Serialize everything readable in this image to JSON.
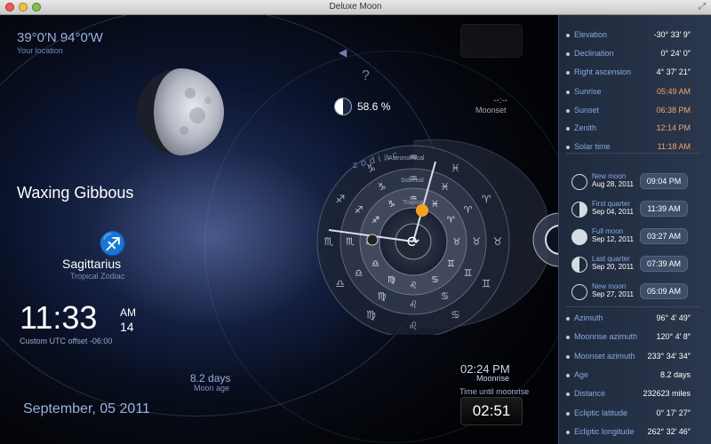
{
  "window": {
    "title": "Deluxe Moon"
  },
  "location": {
    "coords": "39°0′N 94°0′W",
    "label": "Your location"
  },
  "phase": {
    "name": "Waxing Gibbous",
    "illumination": "58.6 %"
  },
  "zodiac": {
    "glyph": "♐",
    "name": "Sagittarius",
    "system": "Tropical Zodiac"
  },
  "time": {
    "clock": "11:33",
    "ampm": "AM",
    "seconds": "14",
    "utc_offset": "Custom UTC offset -06:00"
  },
  "moon_age": {
    "value": "8.2 days",
    "label": "Moon age"
  },
  "date": "September, 05 2011",
  "moonset": {
    "value": "--:--",
    "label": "Moonset"
  },
  "moonrise": {
    "time": "02:24 PM",
    "label": "Moonrise",
    "until_label": "Time until moonrise",
    "countdown": "02:51"
  },
  "dial": {
    "word": "zodiac",
    "rings": [
      "Astronomical",
      "Sidereal",
      "Tropical"
    ],
    "outer_signs": [
      "♐",
      "♑",
      "♒",
      "♓",
      "♈",
      "♉",
      "♊",
      "♋",
      "♌",
      "♍",
      "♎",
      "♏"
    ],
    "middle_signs": [
      "♐",
      "♑",
      "♒",
      "♓",
      "♈",
      "♉",
      "♊",
      "♋",
      "♌",
      "♍",
      "♎",
      "♏"
    ],
    "inner_signs": [
      "♐",
      "♑",
      "♒",
      "♓",
      "♈",
      "♉",
      "♊",
      "♋",
      "♌",
      "♍",
      "♎",
      "♏"
    ],
    "center_icon": "refresh-icon"
  },
  "colors": {
    "accent": "#8aa8e3",
    "orange": "#f0a66c",
    "panel": "#26324a"
  },
  "coordinates": [
    {
      "label": "Elevation",
      "value": "-30° 33′ 9″",
      "highlight": false
    },
    {
      "label": "Declination",
      "value": "0° 24′ 0″",
      "highlight": false
    },
    {
      "label": "Right ascension",
      "value": "4° 37′ 21″",
      "highlight": false
    }
  ],
  "times": [
    {
      "label": "Sunrise",
      "value": "05:49 AM",
      "highlight": true
    },
    {
      "label": "Sunset",
      "value": "06:38 PM",
      "highlight": true
    },
    {
      "label": "Zenith",
      "value": "12:14 PM",
      "highlight": true
    },
    {
      "label": "Solar time",
      "value": "11:18 AM",
      "highlight": true
    }
  ],
  "phases": [
    {
      "name": "New moon",
      "date": "Aug 28, 2011",
      "time": "09:04 PM",
      "icon": "new-moon-icon"
    },
    {
      "name": "First quarter",
      "date": "Sep 04, 2011",
      "time": "11:39 AM",
      "icon": "first-quarter-icon"
    },
    {
      "name": "Full moon",
      "date": "Sep 12, 2011",
      "time": "03:27 AM",
      "icon": "full-moon-icon"
    },
    {
      "name": "Last quarter",
      "date": "Sep 20, 2011",
      "time": "07:39 AM",
      "icon": "last-quarter-icon"
    },
    {
      "name": "New moon",
      "date": "Sep 27, 2011",
      "time": "05:09 AM",
      "icon": "new-moon-icon"
    }
  ],
  "details": [
    {
      "label": "Azimuth",
      "value": "96° 4′ 49″"
    },
    {
      "label": "Moonrise azimuth",
      "value": "120° 4′ 8″"
    },
    {
      "label": "Moonset azimuth",
      "value": "233° 34′ 34″"
    },
    {
      "label": "Age",
      "value": "8.2 days"
    },
    {
      "label": "Distance",
      "value": "232623 miles"
    },
    {
      "label": "Ecliptic latitude",
      "value": "0° 17′ 27″"
    },
    {
      "label": "Ecliptic longitude",
      "value": "262° 32′ 46″"
    }
  ]
}
